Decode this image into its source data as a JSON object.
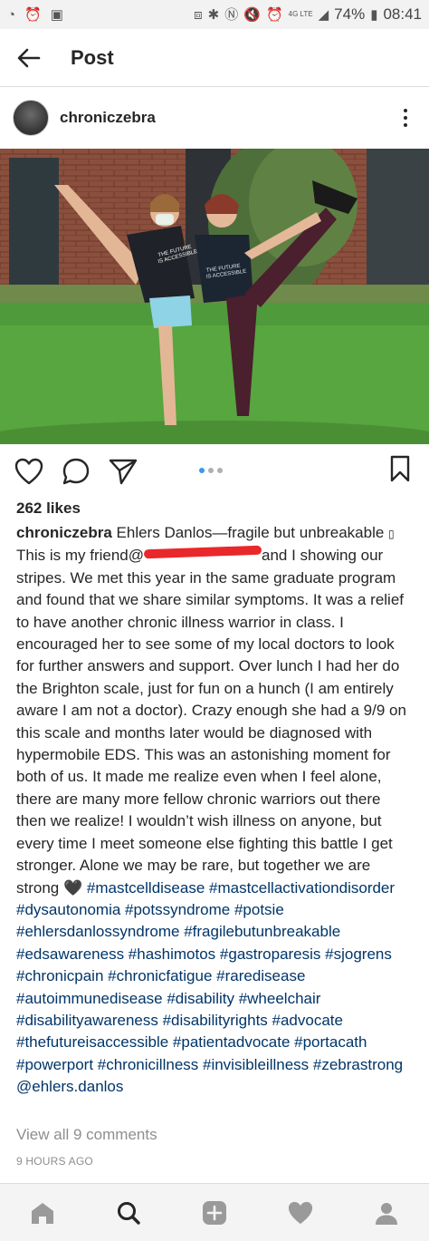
{
  "status_bar": {
    "left_icons": [
      "speedometer-icon",
      "alarm-icon",
      "image-icon"
    ],
    "right_icons": [
      "cast-icon",
      "bluetooth-icon",
      "nfc-icon",
      "mute-icon",
      "alarm-icon",
      "signal-icon"
    ],
    "network": "4G LTE",
    "battery": "74%",
    "time": "08:41"
  },
  "app_bar": {
    "back_icon": "arrow-left-icon",
    "title": "Post"
  },
  "post": {
    "username": "chroniczebra",
    "more_icon": "more-vertical-icon",
    "carousel": {
      "count": 3,
      "active_index": 0
    },
    "likes": "262 likes",
    "caption": {
      "username": "chroniczebra",
      "part1": " Ehlers Danlos—fragile but unbreakable ",
      "emoji_box": "▯",
      "part2": " This is my friend@",
      "part3": "and I showing our stripes. We met this year in the same graduate program and found that we share similar symptoms. It was a relief to have another chronic illness warrior in class. I encouraged her to see some of my local doctors to look for further answers and support. Over lunch I had her do the Brighton scale, just for fun on a hunch (I am entirely aware I am not a doctor). Crazy enough she had a 9/9 on this scale and months later would be diagnosed with hypermobile EDS. This was an astonishing moment for both of us. It made me realize even when I feel alone, there are many more fellow chronic warriors out there then we realize! I wouldn’t wish illness on anyone, but every time I meet someone else fighting this battle I get stronger. Alone we may be rare, but together we are strong ",
      "heart": "🖤",
      "hashtags": "#mastcelldisease #mastcellactivationdisorder #dysautonomia #potssyndrome #potsie #ehlersdanlossyndrome #fragilebutunbreakable #edsawareness #hashimotos #gastroparesis #sjogrens #chronicpain #chronicfatigue #raredisease #autoimmunedisease #disability #wheelchair #disabilityawareness #disabilityrights #advocate #thefutureisaccessible #patientadvocate #portacath #powerport #chronicillness #invisibleillness #zebrastrong @ehlers.danlos"
    },
    "view_comments": "View all 9 comments",
    "time_ago": "9 HOURS AGO",
    "shirt_text": "THE FUTURE IS ACCESSIBLE"
  },
  "nav": {
    "items": [
      "home-icon",
      "search-icon",
      "add-post-icon",
      "activity-heart-icon",
      "profile-icon"
    ],
    "active": "search-icon"
  },
  "colors": {
    "accent_blue": "#3897f0",
    "hashtag": "#003569",
    "redaction": "#e8282a"
  }
}
